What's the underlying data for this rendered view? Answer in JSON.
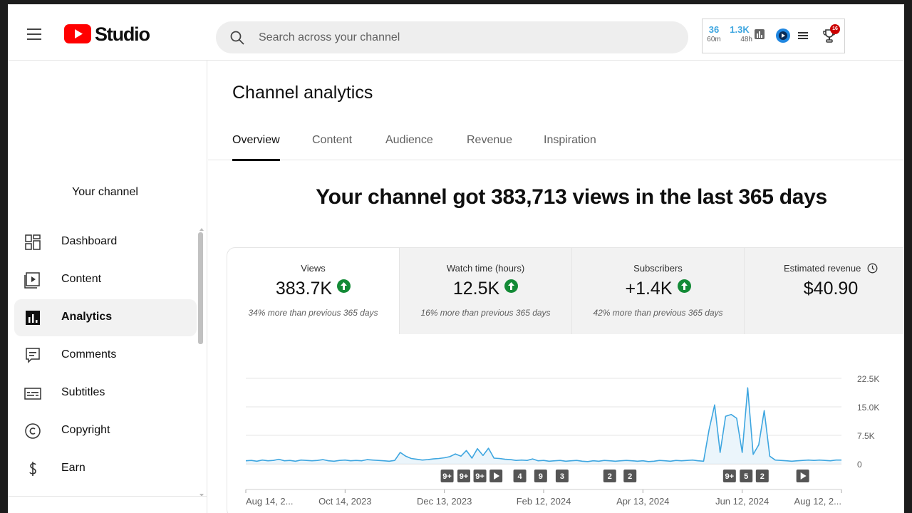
{
  "app": {
    "logo_text": "Studio"
  },
  "search": {
    "placeholder": "Search across your channel"
  },
  "header_stats": [
    {
      "value": "36",
      "label": "60m"
    },
    {
      "value": "1.3K",
      "label": "48h"
    }
  ],
  "notifications": {
    "count": "16"
  },
  "sidebar": {
    "channel_label": "Your channel",
    "items": [
      {
        "label": "Dashboard",
        "icon": "dashboard-icon"
      },
      {
        "label": "Content",
        "icon": "content-icon"
      },
      {
        "label": "Analytics",
        "icon": "analytics-icon",
        "active": true
      },
      {
        "label": "Comments",
        "icon": "comments-icon"
      },
      {
        "label": "Subtitles",
        "icon": "subtitles-icon"
      },
      {
        "label": "Copyright",
        "icon": "copyright-icon"
      },
      {
        "label": "Earn",
        "icon": "earn-icon"
      }
    ]
  },
  "page": {
    "title": "Channel analytics",
    "tabs": [
      "Overview",
      "Content",
      "Audience",
      "Revenue",
      "Inspiration"
    ],
    "active_tab": "Overview",
    "headline": "Your channel got 383,713 views in the last 365 days"
  },
  "metrics": [
    {
      "label": "Views",
      "value": "383.7K",
      "trend": "up",
      "note": "34% more than previous 365 days"
    },
    {
      "label": "Watch time (hours)",
      "value": "12.5K",
      "trend": "up",
      "note": "16% more than previous 365 days"
    },
    {
      "label": "Subscribers",
      "value": "+1.4K",
      "trend": "up",
      "note": "42% more than previous 365 days"
    },
    {
      "label": "Estimated revenue",
      "value": "$40.90",
      "trend": "none",
      "note": ""
    }
  ],
  "colors": {
    "accent": "#3ea6e0",
    "brand_red": "#ff0000",
    "up_green": "#138a36"
  },
  "chart_data": {
    "type": "line",
    "series": [
      {
        "values": [
          800,
          900,
          700,
          1000,
          800,
          900,
          1200,
          800,
          900,
          700,
          1000,
          900,
          800,
          900,
          1100,
          800,
          700,
          900,
          1000,
          800,
          900,
          800,
          1100,
          1000,
          900,
          800,
          700,
          900,
          3000,
          2000,
          1400,
          1200,
          1000,
          1100,
          1300,
          1400,
          1600,
          1900,
          2600,
          2000,
          3500,
          1500,
          4000,
          2200,
          4100,
          1500,
          1400,
          1200,
          1100,
          900,
          1000,
          900,
          1300,
          800,
          900,
          700,
          800,
          900,
          700,
          800,
          900,
          700,
          600,
          800,
          700,
          900,
          800,
          700,
          800,
          900,
          800,
          700,
          800,
          600,
          700,
          900,
          800,
          700,
          900,
          800,
          900,
          1000,
          800,
          700,
          9000,
          15500,
          3000,
          12500,
          13000,
          12000,
          3000,
          20000,
          2500,
          5000,
          14000,
          2000,
          1000,
          900,
          800,
          700,
          800,
          900,
          1000,
          900,
          1000,
          900,
          800,
          1000,
          1000
        ]
      }
    ],
    "x_tick_labels": [
      "Aug 14, 2...",
      "Oct 14, 2023",
      "Dec 13, 2023",
      "Feb 12, 2024",
      "Apr 13, 2024",
      "Jun 12, 2024",
      "Aug 12, 2..."
    ],
    "y_tick_labels": [
      "22.5K",
      "15.0K",
      "7.5K",
      "0"
    ],
    "ylim": [
      0,
      22500
    ],
    "grid": true,
    "markers": [
      {
        "label": "9+",
        "at": 0.338
      },
      {
        "label": "9+",
        "at": 0.366
      },
      {
        "label": "9+",
        "at": 0.393
      },
      {
        "label": "play",
        "at": 0.42
      },
      {
        "label": "4",
        "at": 0.46
      },
      {
        "label": "9",
        "at": 0.495
      },
      {
        "label": "3",
        "at": 0.531
      },
      {
        "label": "2",
        "at": 0.611
      },
      {
        "label": "2",
        "at": 0.645
      },
      {
        "label": "9+",
        "at": 0.812
      },
      {
        "label": "5",
        "at": 0.84
      },
      {
        "label": "2",
        "at": 0.867
      },
      {
        "label": "play",
        "at": 0.935
      }
    ]
  }
}
